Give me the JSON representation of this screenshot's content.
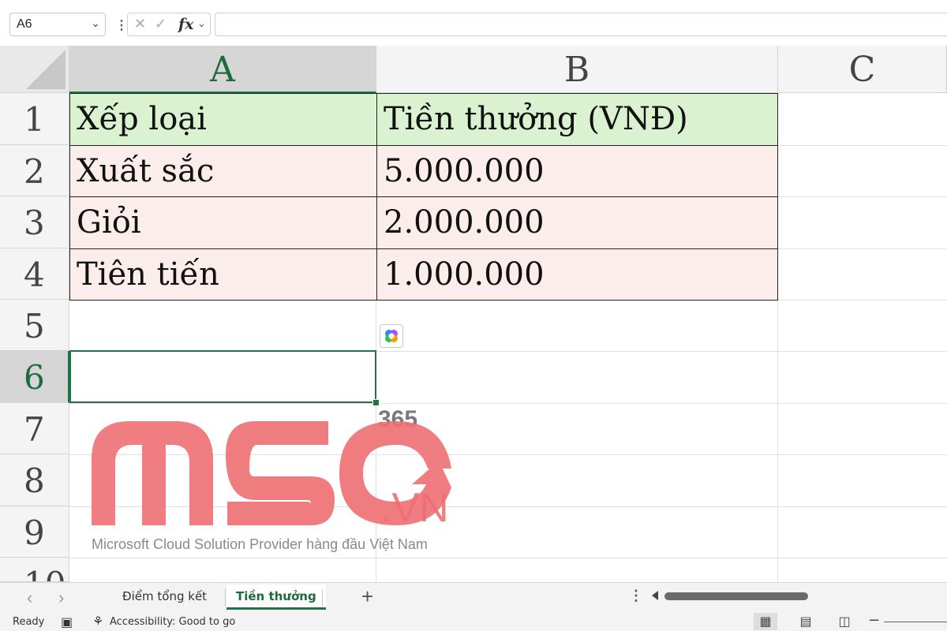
{
  "formula_bar": {
    "name_box": "A6",
    "cancel_icon": "cancel-icon",
    "enter_icon": "check-icon",
    "fx_label": "fx",
    "formula": ""
  },
  "columns": [
    "A",
    "B",
    "C"
  ],
  "rows": [
    "1",
    "2",
    "3",
    "4",
    "5",
    "6",
    "7",
    "8",
    "9",
    "10"
  ],
  "selected_cell": "A6",
  "table": {
    "header": [
      "Xếp loại",
      "Tiền thưởng (VNĐ)"
    ],
    "rows": [
      [
        "Xuất sắc",
        "5.000.000"
      ],
      [
        "Giỏi",
        "2.000.000"
      ],
      [
        "Tiên tiến",
        "1.000.000"
      ]
    ],
    "header_color": "#daf2d0",
    "data_color": "#fbeeea"
  },
  "watermark": {
    "logo": "MSO",
    "suffix": ".VN",
    "number": "365",
    "tagline": "Microsoft Cloud Solution Provider hàng đầu Việt Nam",
    "color": "#ee6f73"
  },
  "sheet_tabs": {
    "tabs": [
      "Điểm tổng kết",
      "Tiền thưởng"
    ],
    "active": "Tiền thưởng",
    "add_label": "+"
  },
  "status_bar": {
    "ready": "Ready",
    "accessibility": "Accessibility: Good to go"
  },
  "accent": "#217346"
}
